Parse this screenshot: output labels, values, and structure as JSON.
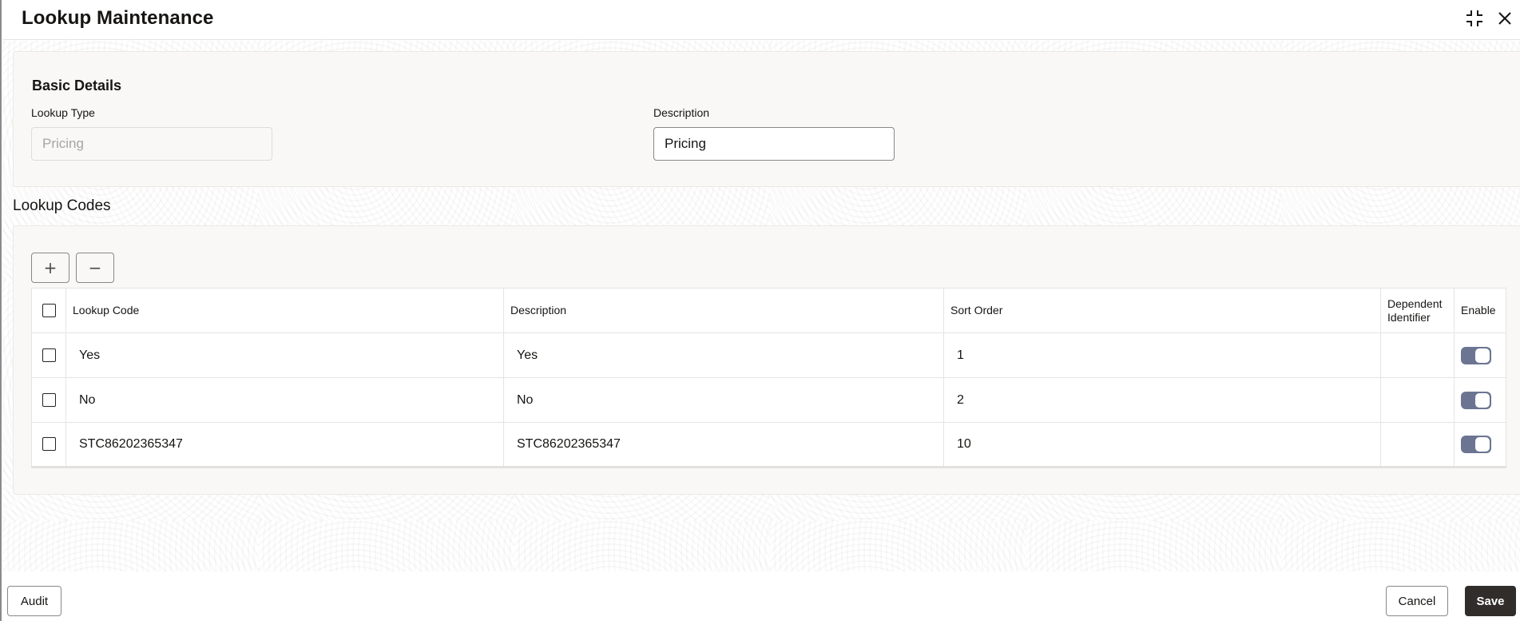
{
  "header": {
    "title": "Lookup Maintenance",
    "icons": {
      "minimize": "minimize-icon",
      "close": "close-icon"
    }
  },
  "basic_details": {
    "title": "Basic Details",
    "lookup_type": {
      "label": "Lookup Type",
      "value": "Pricing",
      "disabled": true
    },
    "description": {
      "label": "Description",
      "value": "Pricing"
    }
  },
  "lookup_codes": {
    "title": "Lookup Codes",
    "toolbar": {
      "add_label": "+",
      "remove_label": "−"
    },
    "columns": [
      "Lookup Code",
      "Description",
      "Sort Order",
      "Dependent Identifier",
      "Enable"
    ],
    "rows": [
      {
        "code": "Yes",
        "description": "Yes",
        "sort_order": "1",
        "dependent_identifier": "",
        "enabled": true,
        "selected": false
      },
      {
        "code": "No",
        "description": "No",
        "sort_order": "2",
        "dependent_identifier": "",
        "enabled": true,
        "selected": false
      },
      {
        "code": "STC86202365347",
        "description": "STC86202365347",
        "sort_order": "10",
        "dependent_identifier": "",
        "enabled": true,
        "selected": false
      }
    ]
  },
  "footer": {
    "audit_label": "Audit",
    "cancel_label": "Cancel",
    "save_label": "Save"
  },
  "colors": {
    "primary_button": "#312d2a",
    "toggle_on": "#6b7592",
    "panel_bg": "#f9f8f6"
  }
}
